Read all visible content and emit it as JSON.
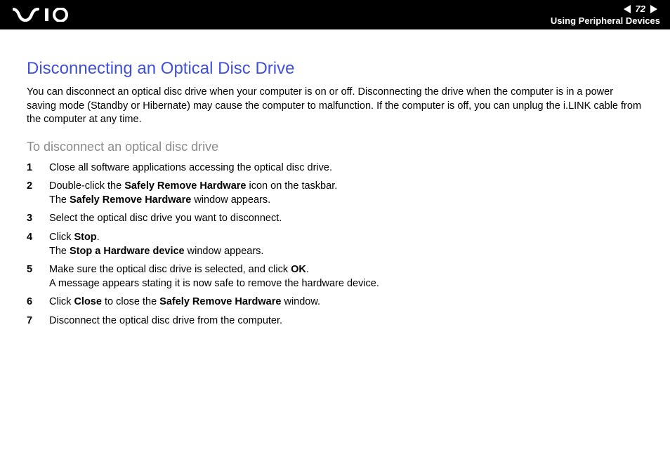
{
  "header": {
    "page_number": "72",
    "section": "Using Peripheral Devices"
  },
  "content": {
    "title": "Disconnecting an Optical Disc Drive",
    "intro": "You can disconnect an optical disc drive when your computer is on or off. Disconnecting the drive when the computer is in a power saving mode (Standby or Hibernate) may cause the computer to malfunction. If the computer is off, you can unplug the i.LINK cable from the computer at any time.",
    "subheading": "To disconnect an optical disc drive",
    "steps": {
      "s1": "Close all software applications accessing the optical disc drive.",
      "s2a": "Double-click the ",
      "s2b": "Safely Remove Hardware",
      "s2c": " icon on the taskbar.",
      "s2d": "The ",
      "s2e": "Safely Remove Hardware",
      "s2f": " window appears.",
      "s3": "Select the optical disc drive you want to disconnect.",
      "s4a": "Click ",
      "s4b": "Stop",
      "s4c": ".",
      "s4d": "The ",
      "s4e": "Stop a Hardware device",
      "s4f": " window appears.",
      "s5a": "Make sure the optical disc drive is selected, and click ",
      "s5b": "OK",
      "s5c": ".",
      "s5d": "A message appears stating it is now safe to remove the hardware device.",
      "s6a": "Click ",
      "s6b": "Close",
      "s6c": " to close the ",
      "s6d": "Safely Remove Hardware",
      "s6e": " window.",
      "s7": "Disconnect the optical disc drive from the computer."
    }
  }
}
